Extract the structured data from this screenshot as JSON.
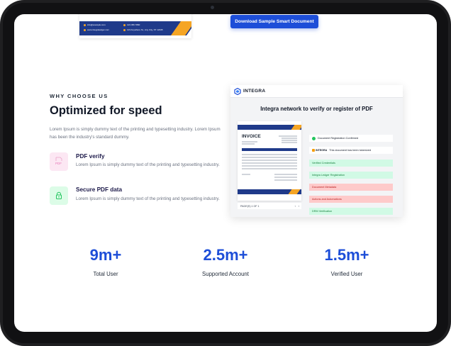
{
  "top_fragment": {
    "contact_1": "info@example.com",
    "contact_2": "www.integraledger.com",
    "phone": "123 456 7890",
    "address": "123 Anywhere St., Any City, ST 12345"
  },
  "cta": {
    "download_label": "Download Sample Smart Document"
  },
  "why": {
    "eyebrow": "WHY CHOOSE US",
    "heading": "Optimized for speed",
    "lead": "Lorem Ipsum is simply dummy text of the printing and typesetting industry. Lorem Ipsum has been the industry's standard dummy."
  },
  "features": [
    {
      "title": "PDF verify",
      "desc": "Lorem Ipsum is simply dummy text of the printing and typesetting industry.",
      "icon": "pdf-icon"
    },
    {
      "title": "Secure PDF data",
      "desc": "Lorem Ipsum is simply dummy text of the printing and typesetting industry.",
      "icon": "lock-icon"
    }
  ],
  "mock": {
    "brand": "INTEGRA",
    "title": "Integra network to verify or register of PDF",
    "invoice_title": "INVOICE",
    "pagebar": "PAGE(S) 1 OF 1",
    "rows": [
      {
        "label": "Document Registration Confirmed",
        "style": "white",
        "icon": "check-circle-icon"
      },
      {
        "label": "This document has been tokenized",
        "style": "white",
        "brand": "INTEGRA"
      },
      {
        "label": "Verified Credentials",
        "style": "green"
      },
      {
        "label": "Integra Ledger Registration",
        "style": "green"
      },
      {
        "label": "Document Metadata",
        "style": "red"
      },
      {
        "label": "Actions and Automations",
        "style": "red"
      },
      {
        "label": "DRM Verification",
        "style": "green"
      }
    ]
  },
  "stats": [
    {
      "value": "9m+",
      "label": "Total User"
    },
    {
      "value": "2.5m+",
      "label": "Supported Account"
    },
    {
      "value": "1.5m+",
      "label": "Verified User"
    }
  ],
  "colors": {
    "accent": "#1d4ed8",
    "navy": "#1f3a8a",
    "orange": "#f5a524",
    "green_bg": "#d1fae5",
    "red_bg": "#fecaca"
  }
}
